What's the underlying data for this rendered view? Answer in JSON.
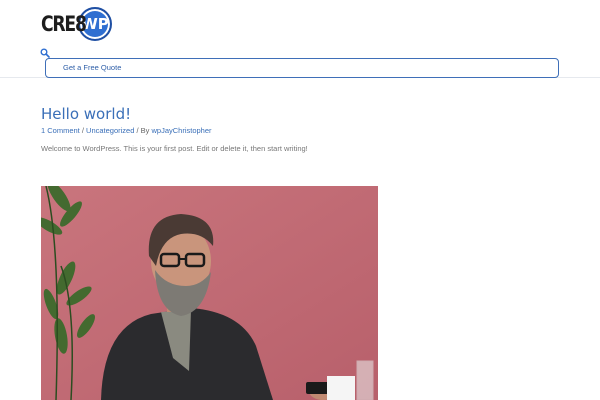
{
  "header": {
    "logo_text": "CRE8",
    "logo_badge": "WP",
    "quote_button": "Get a Free Quote"
  },
  "post": {
    "title": "Hello world!",
    "comments": "1 Comment",
    "sep1": " / ",
    "category": "Uncategorized",
    "by": " / By ",
    "author": "wpJayChristopher",
    "excerpt": "Welcome to WordPress. This is your first post. Edit or delete it, then start writing!"
  },
  "colors": {
    "accent": "#3a6fb8",
    "image_bg": "#c56f78"
  },
  "icons": {
    "search": "search-icon"
  }
}
